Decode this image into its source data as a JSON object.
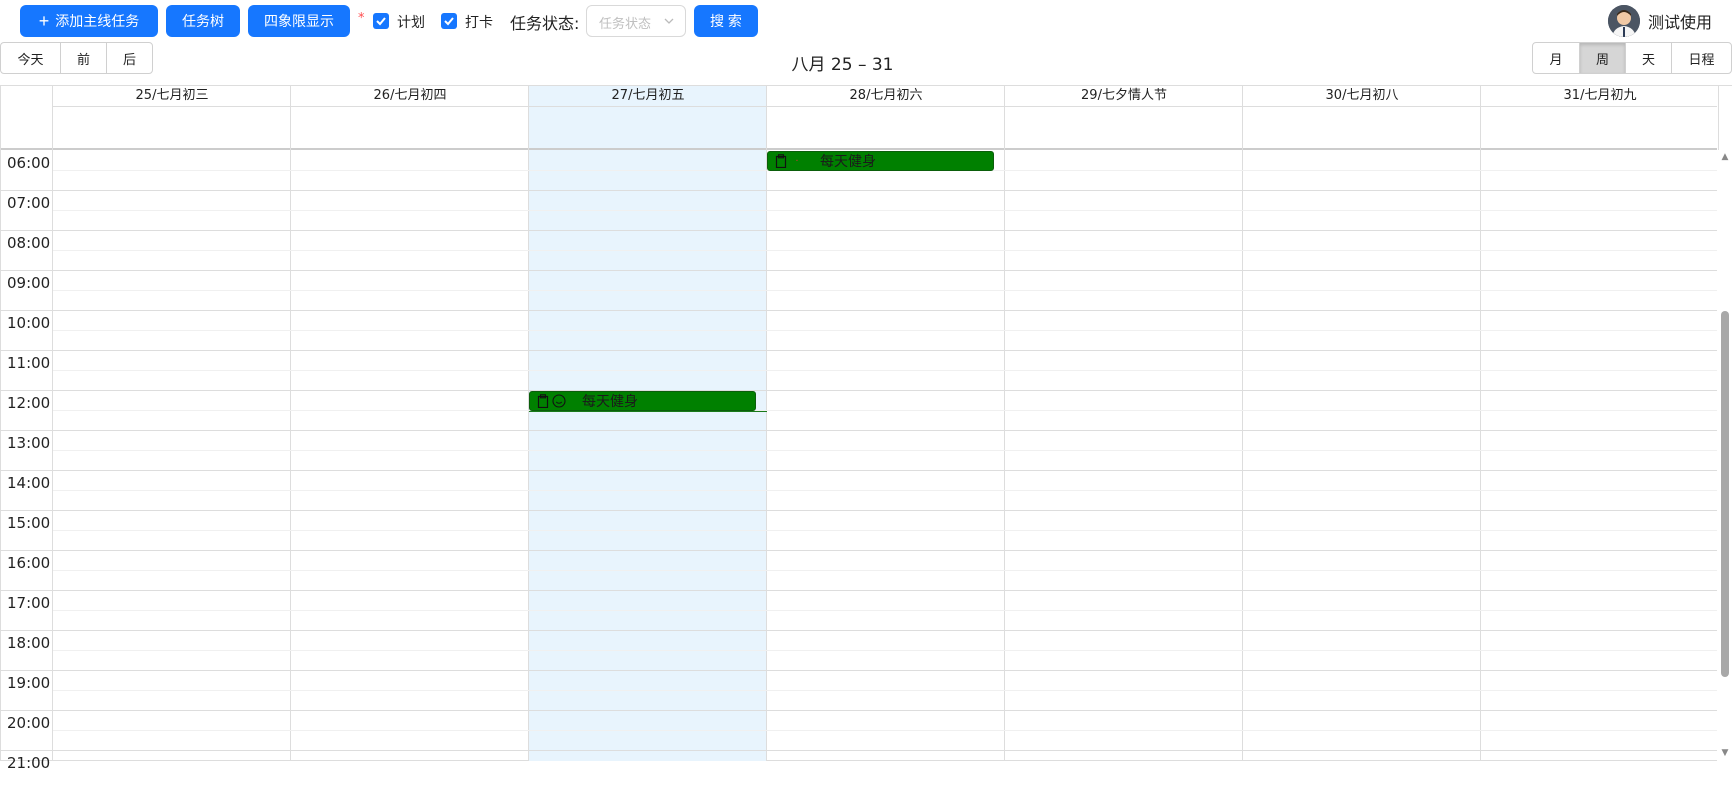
{
  "toolbar": {
    "add_task": "添加主线任务",
    "task_tree": "任务树",
    "quadrant": "四象限显示",
    "required_mark": "*",
    "check_plan": "计划",
    "check_punch": "打卡",
    "status_label": "任务状态:",
    "status_placeholder": "任务状态",
    "search": "搜 索"
  },
  "user": {
    "name": "测试使用"
  },
  "nav": {
    "today": "今天",
    "prev": "前",
    "next": "后"
  },
  "range_title": "八月 25 – 31",
  "views": {
    "month": "月",
    "week": "周",
    "day": "天",
    "agenda": "日程",
    "active": "周"
  },
  "days": [
    {
      "label": "25/七月初三"
    },
    {
      "label": "26/七月初四"
    },
    {
      "label": "27/七月初五",
      "today": true
    },
    {
      "label": "28/七月初六"
    },
    {
      "label": "29/七夕情人节"
    },
    {
      "label": "30/七月初八"
    },
    {
      "label": "31/七月初九"
    }
  ],
  "hours": [
    "06:00",
    "07:00",
    "08:00",
    "09:00",
    "10:00",
    "11:00",
    "12:00",
    "13:00",
    "14:00",
    "15:00",
    "16:00",
    "17:00",
    "18:00",
    "19:00",
    "20:00",
    "21:00"
  ],
  "events": [
    {
      "day": "28/七月初六",
      "start": "06:00",
      "title": "每天健身",
      "color": "#008000"
    },
    {
      "day": "27/七月初五",
      "start": "12:00",
      "title": "每天健身",
      "color": "#008000"
    }
  ]
}
